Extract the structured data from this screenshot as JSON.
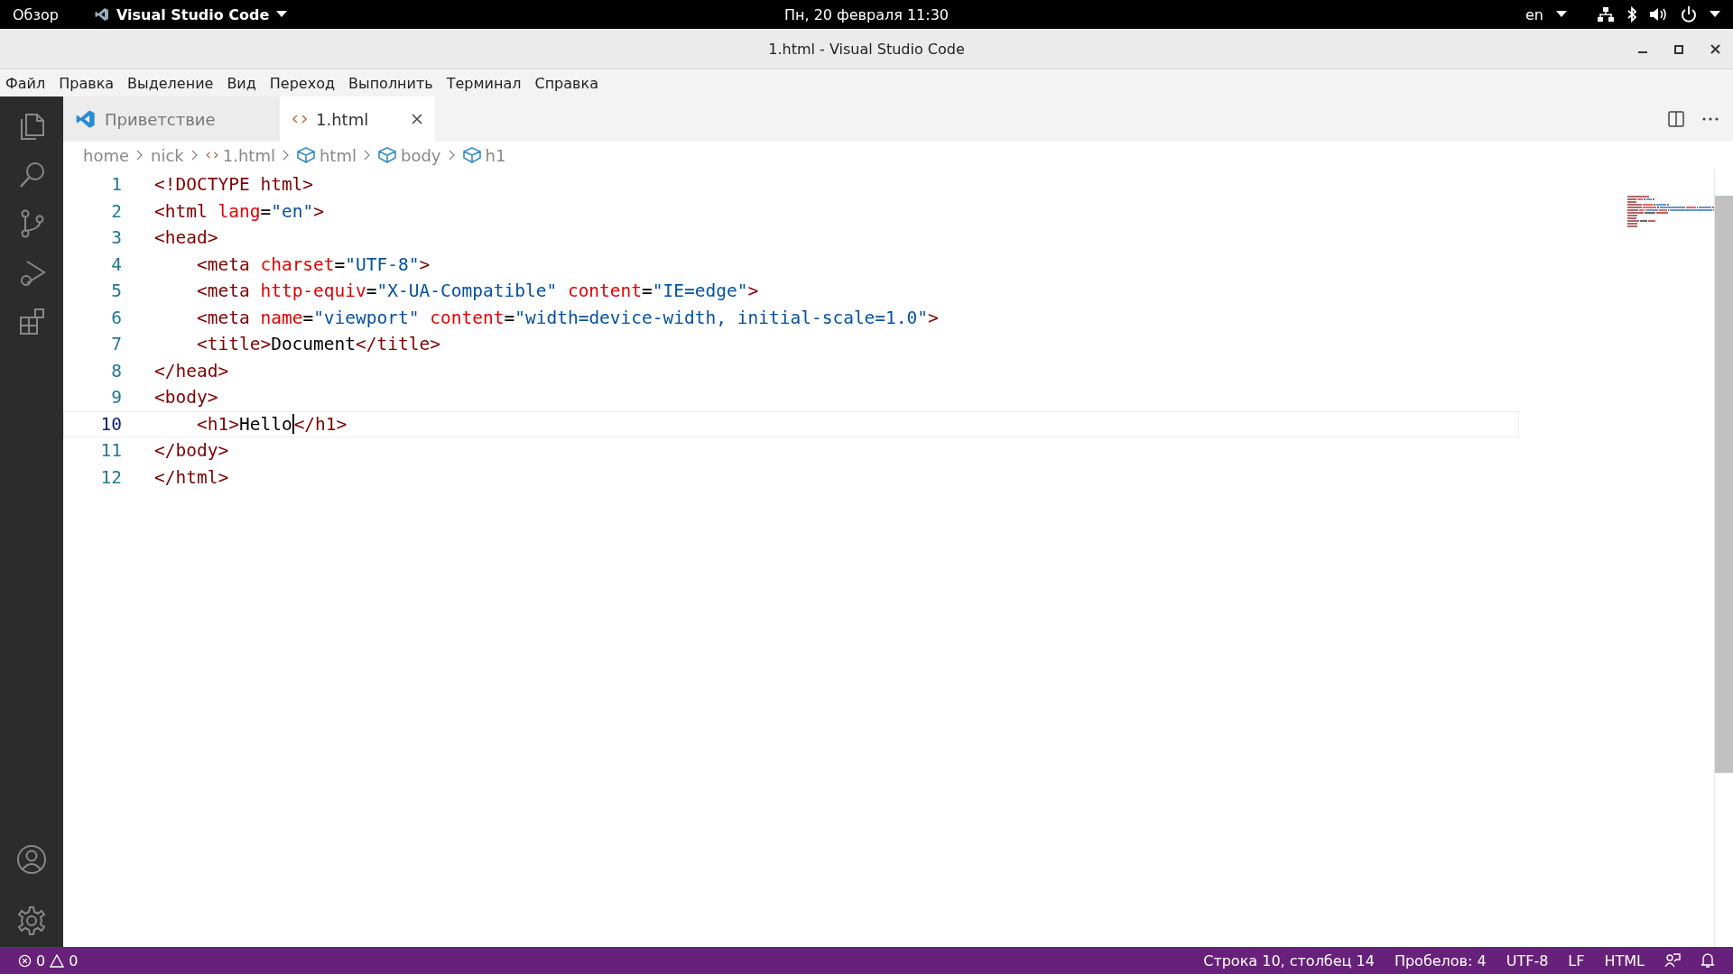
{
  "top_bar": {
    "activities": "Обзор",
    "app": "Visual Studio Code",
    "clock": "Пн, 20 февраля  11:30",
    "language": "en"
  },
  "window": {
    "title": "1.html - Visual Studio Code"
  },
  "menu": [
    "Файл",
    "Правка",
    "Выделение",
    "Вид",
    "Переход",
    "Выполнить",
    "Терминал",
    "Справка"
  ],
  "activity_bar": [
    {
      "kind": "files",
      "selected": false
    },
    {
      "kind": "search",
      "selected": false
    },
    {
      "kind": "git",
      "selected": false
    },
    {
      "kind": "debug",
      "selected": false
    },
    {
      "kind": "extensions",
      "selected": false
    }
  ],
  "tabs": [
    {
      "label": "Приветствие",
      "kind": "welcome",
      "selected": false
    },
    {
      "label": "1.html",
      "kind": "html",
      "selected": true
    }
  ],
  "breadcrumbs": [
    {
      "label": "home",
      "kind": "folder"
    },
    {
      "label": "nick",
      "kind": "folder"
    },
    {
      "label": "1.html",
      "kind": "file"
    },
    {
      "label": "html",
      "kind": "element"
    },
    {
      "label": "body",
      "kind": "element"
    },
    {
      "label": "h1",
      "kind": "element"
    }
  ],
  "editor": {
    "lines": [
      {
        "number": "1",
        "current": false,
        "tokens": [
          {
            "kind": "tag",
            "text": "<!DOCTYPE html>"
          }
        ]
      },
      {
        "number": "2",
        "current": false,
        "tokens": [
          {
            "kind": "tag",
            "text": "<html "
          },
          {
            "kind": "attr",
            "text": "lang"
          },
          {
            "kind": "plain",
            "text": "="
          },
          {
            "kind": "str",
            "text": "\"en\""
          },
          {
            "kind": "tag",
            "text": ">"
          }
        ]
      },
      {
        "number": "3",
        "current": false,
        "tokens": [
          {
            "kind": "tag",
            "text": "<head>"
          }
        ]
      },
      {
        "number": "4",
        "current": false,
        "tokens": [
          {
            "kind": "tag",
            "text": "    <meta "
          },
          {
            "kind": "attr",
            "text": "charset"
          },
          {
            "kind": "plain",
            "text": "="
          },
          {
            "kind": "str",
            "text": "\"UTF-8\""
          },
          {
            "kind": "tag",
            "text": ">"
          }
        ]
      },
      {
        "number": "5",
        "current": false,
        "tokens": [
          {
            "kind": "tag",
            "text": "    <meta "
          },
          {
            "kind": "attr",
            "text": "http-equiv"
          },
          {
            "kind": "plain",
            "text": "="
          },
          {
            "kind": "str",
            "text": "\"X-UA-Compatible\" "
          },
          {
            "kind": "attr",
            "text": "content"
          },
          {
            "kind": "plain",
            "text": "="
          },
          {
            "kind": "str",
            "text": "\"IE=edge\""
          },
          {
            "kind": "tag",
            "text": ">"
          }
        ]
      },
      {
        "number": "6",
        "current": false,
        "tokens": [
          {
            "kind": "tag",
            "text": "    <meta "
          },
          {
            "kind": "attr",
            "text": "name"
          },
          {
            "kind": "plain",
            "text": "="
          },
          {
            "kind": "str",
            "text": "\"viewport\" "
          },
          {
            "kind": "attr",
            "text": "content"
          },
          {
            "kind": "plain",
            "text": "="
          },
          {
            "kind": "str",
            "text": "\"width=device-width, initial-scale=1.0\""
          },
          {
            "kind": "tag",
            "text": ">"
          }
        ]
      },
      {
        "number": "7",
        "current": false,
        "tokens": [
          {
            "kind": "tag",
            "text": "    <title>"
          },
          {
            "kind": "plain",
            "text": "Document"
          },
          {
            "kind": "tag",
            "text": "</title>"
          }
        ]
      },
      {
        "number": "8",
        "current": false,
        "tokens": [
          {
            "kind": "tag",
            "text": "</head>"
          }
        ]
      },
      {
        "number": "9",
        "current": false,
        "tokens": [
          {
            "kind": "tag",
            "text": "<body>"
          }
        ]
      },
      {
        "number": "10",
        "current": true,
        "tokens": [
          {
            "kind": "tag",
            "text": "    <h1>"
          },
          {
            "kind": "plain",
            "text": "Hello",
            "caret": true
          },
          {
            "kind": "tag",
            "text": "</h1>"
          }
        ]
      },
      {
        "number": "11",
        "current": false,
        "tokens": [
          {
            "kind": "tag",
            "text": "</body>"
          }
        ]
      },
      {
        "number": "12",
        "current": false,
        "tokens": [
          {
            "kind": "tag",
            "text": "</html>"
          }
        ]
      }
    ]
  },
  "status_bar": {
    "errors": "0",
    "warnings": "0",
    "position": "Строка 10, столбец 14",
    "indent": "Пробелов: 4",
    "encoding": "UTF-8",
    "eol": "LF",
    "language": "HTML"
  }
}
